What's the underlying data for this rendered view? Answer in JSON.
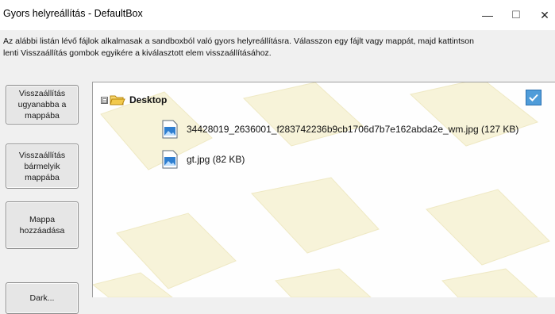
{
  "window": {
    "title": "Gyors helyreállítás - DefaultBox",
    "minimize_glyph": "—",
    "maximize_glyph": "☐",
    "close_glyph": "✕"
  },
  "description": {
    "line1": "Az alábbi listán lévő fájlok alkalmasak a sandboxból való gyors helyreállításra.  Válasszon egy fájlt vagy mappát, majd kattintson",
    "line2": "lenti Visszaállítás gombok egyikére a kiválasztott elem visszaállításához."
  },
  "buttons": {
    "restore_same": "Visszaállítás\nugyanabba a\nmappába",
    "restore_any": "Visszaállítás\nbármelyik\nmappába",
    "add_folder": "Mappa\nhozzáadása",
    "fourth_partial": "Dark..."
  },
  "tree": {
    "expander_glyph": "⊟",
    "root_label": "Desktop",
    "files": [
      {
        "label": "34428019_2636001_f283742236b9cb1706d7b7e162abda2e_wm.jpg  (127 KB)"
      },
      {
        "label": "gt.jpg  (82 KB)"
      }
    ],
    "checkbox_checked": true
  },
  "icons": {
    "folder": "folder-open-icon",
    "image_file": "image-file-icon",
    "check": "checkmark-icon"
  },
  "colors": {
    "accent": "#4f9cd9",
    "folder": "#f2c94c",
    "watermark": "#f7f3d9"
  }
}
